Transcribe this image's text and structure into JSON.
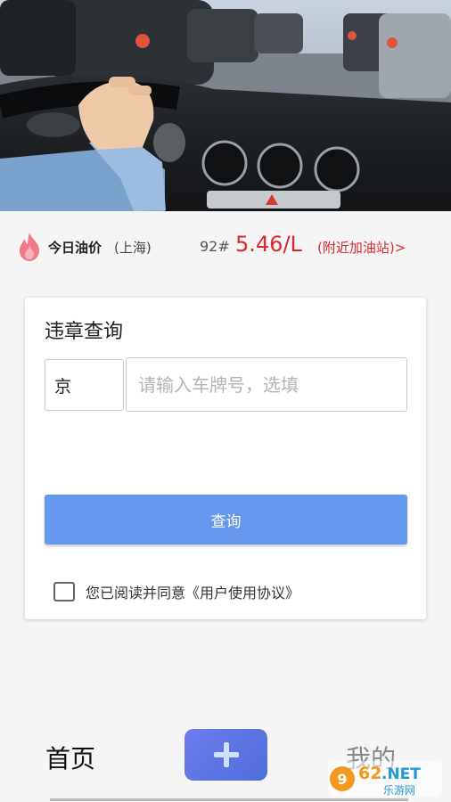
{
  "banner": {
    "image": "car-interior-photo"
  },
  "oil": {
    "icon": "flame-icon",
    "title": "今日油价",
    "city": "(上海)",
    "grade": "92#",
    "price": "5.46/L",
    "nearby": "(附近加油站)>",
    "price_color": "#d9272e"
  },
  "card": {
    "title": "违章查询",
    "province": "京",
    "plate_placeholder": "请输入车牌号，选填",
    "plate_value": "",
    "query_label": "查询",
    "agreement_checked": false,
    "agreement_text": "您已阅读并同意《用户使用协议》",
    "accent": "#6699ee"
  },
  "tabs": {
    "home": "首页",
    "add_icon": "plus-icon",
    "mine": "我的"
  },
  "watermark": {
    "brand": "962.NET",
    "sub": "乐游网"
  }
}
